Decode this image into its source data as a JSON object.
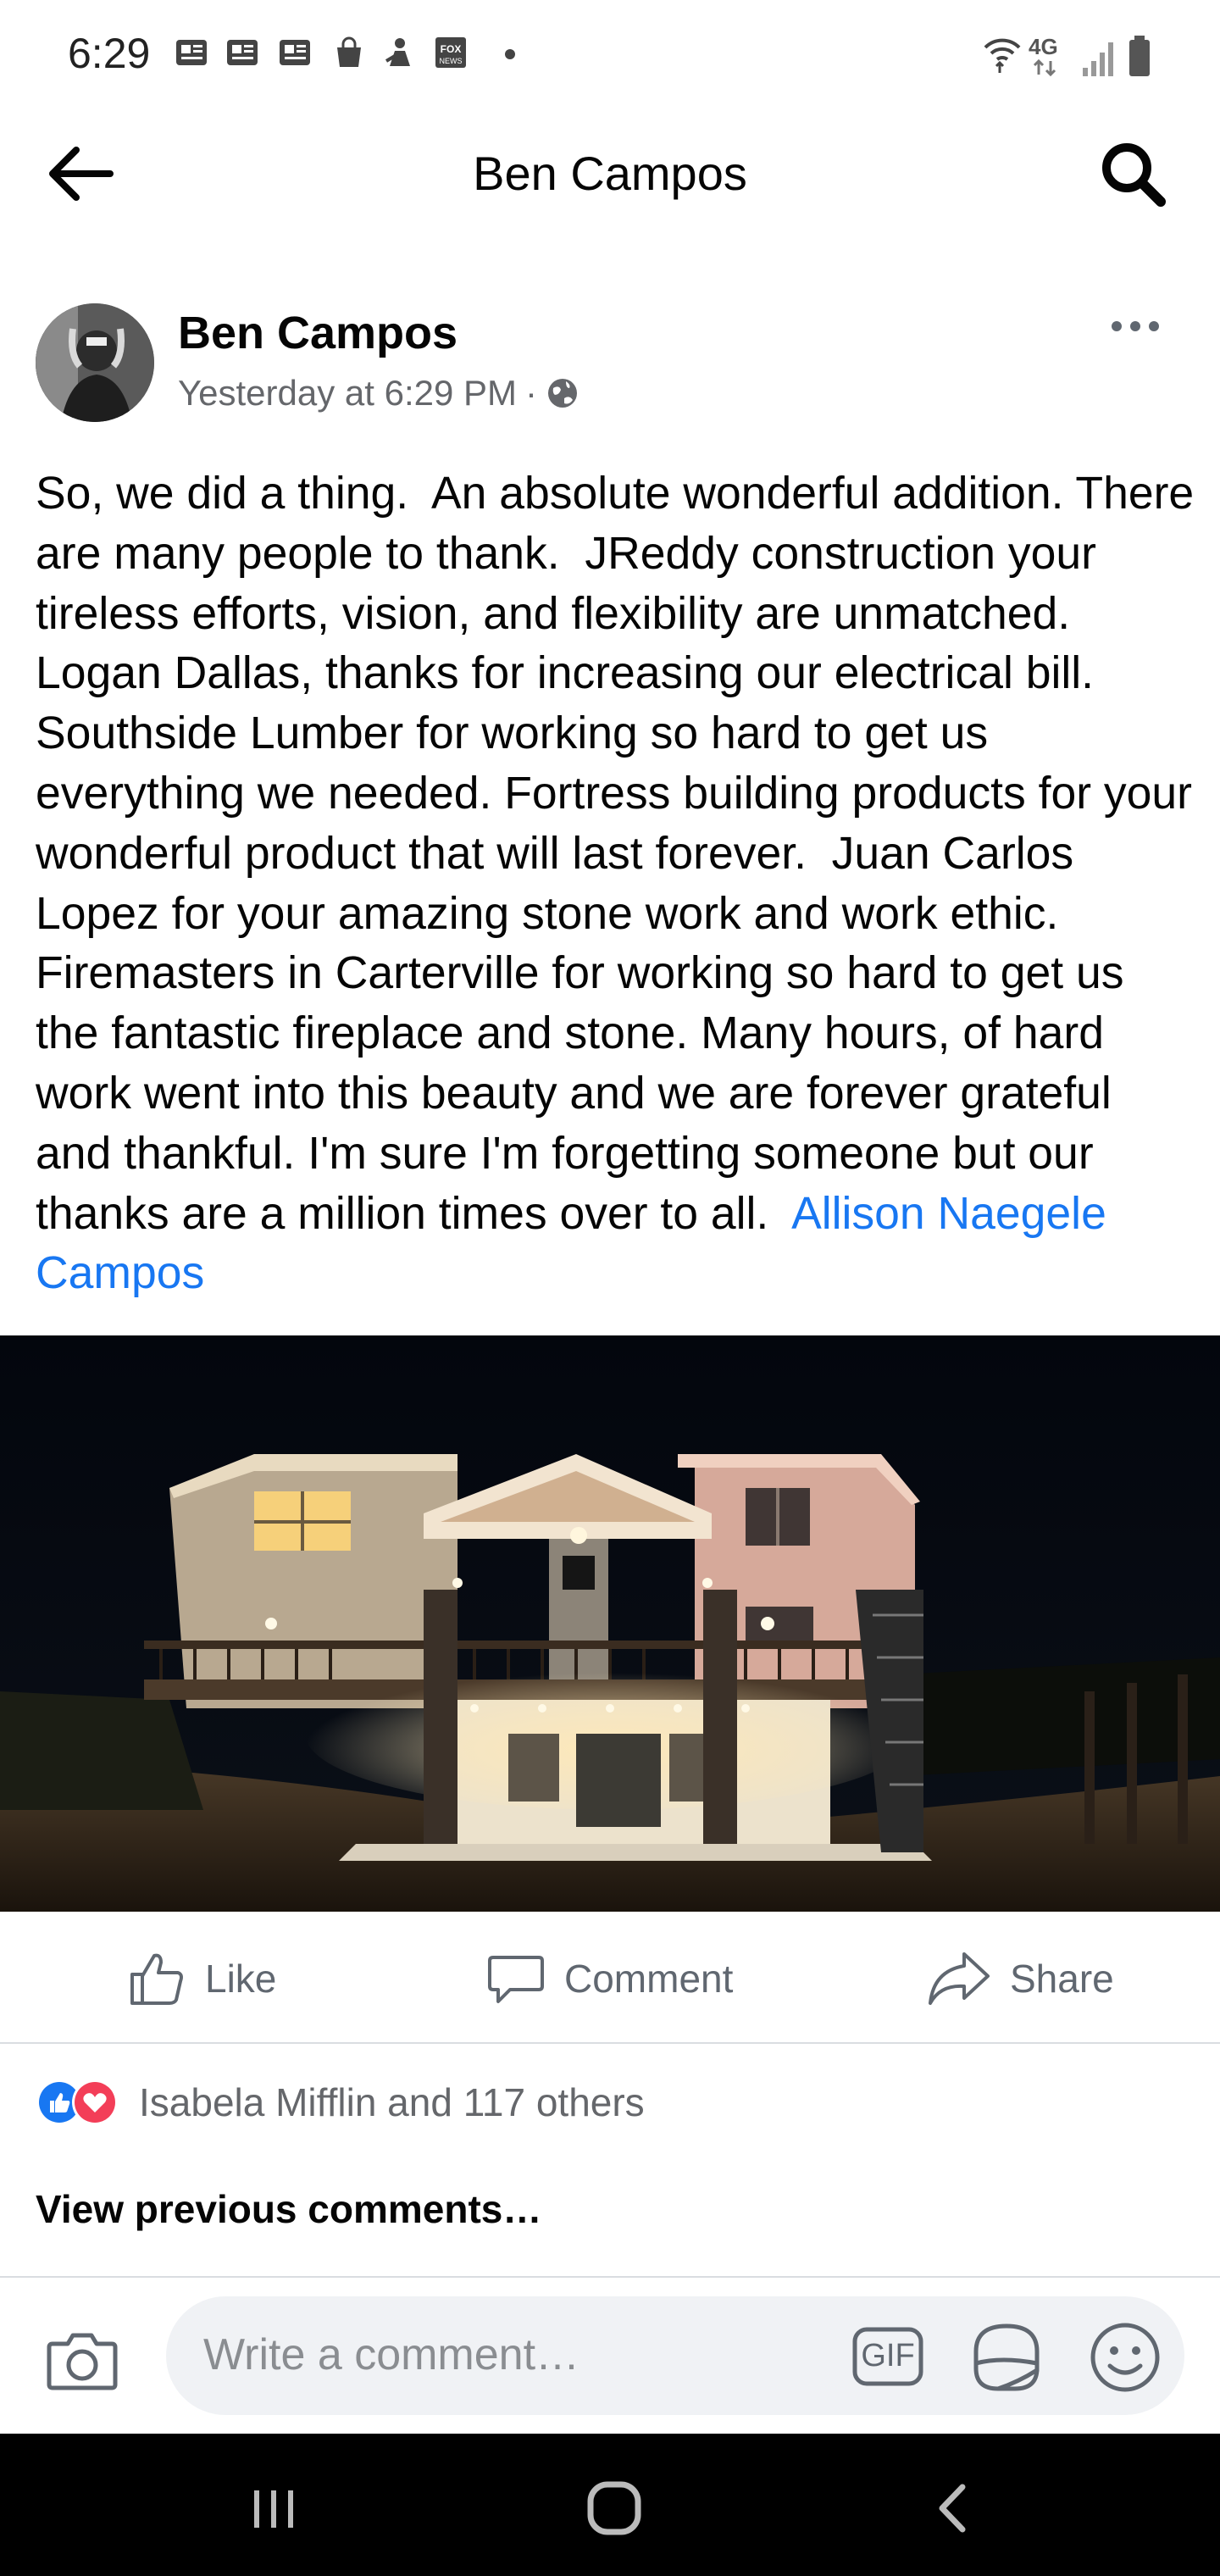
{
  "status_bar": {
    "time": "6:29",
    "notification_icons": [
      "news-icon",
      "news-icon",
      "news-icon",
      "shopping-bag-icon",
      "app-icon",
      "fox-news-icon",
      "dot-icon"
    ],
    "network_label": "4G",
    "system_icons": [
      "wifi-icon",
      "network-4g-icon",
      "signal-icon",
      "battery-icon"
    ]
  },
  "header": {
    "title": "Ben Campos",
    "back_icon": "arrow-left-icon",
    "search_icon": "search-icon"
  },
  "post": {
    "author": "Ben Campos",
    "timestamp": "Yesterday at 6:29 PM",
    "separator": "·",
    "privacy_icon": "globe-icon",
    "more_icon": "more-horizontal-icon",
    "text": "So, we did a thing.  An absolute wonderful addition. There are many people to thank.  JReddy construction your tireless efforts, vision, and flexibility are unmatched.  Logan Dallas, thanks for increasing our electrical bill. Southside Lumber for working so hard to get us everything we needed. Fortress building products for your wonderful product that will last forever.  Juan Carlos Lopez for your amazing stone work and work ethic.  Firemasters in Carterville for working so hard to get us the fantastic fireplace and stone. Many hours, of hard work went into this beauty and we are forever grateful and thankful. I'm sure I'm forgetting someone but our thanks are a million times over to all.  ",
    "mention": "Allison Naegele Campos",
    "mention_color": "#1877f2"
  },
  "actions": {
    "like": "Like",
    "comment": "Comment",
    "share": "Share"
  },
  "reactions": {
    "icons": [
      "like-reaction-icon",
      "love-reaction-icon"
    ],
    "like_color": "#1877f2",
    "love_color": "#f33e58",
    "text": "Isabela Mifflin and 117 others"
  },
  "comments": {
    "view_previous": "View previous comments…"
  },
  "composer": {
    "placeholder": "Write a comment…",
    "value": "",
    "gif_label": "GIF"
  },
  "navigation": {
    "icons": [
      "recent-apps-icon",
      "home-icon",
      "back-icon"
    ]
  }
}
